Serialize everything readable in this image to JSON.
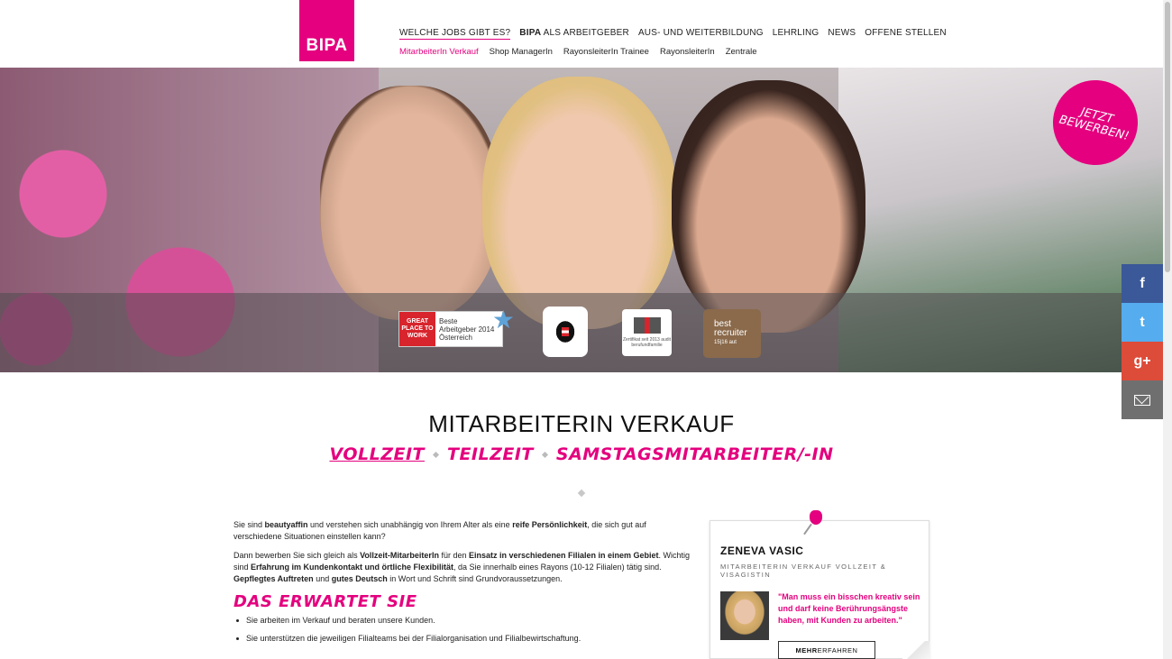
{
  "logo": {
    "text": "BIPA",
    "color": "#e4007e"
  },
  "nav": {
    "main": [
      {
        "pre": "",
        "label": "WELCHE JOBS GIBT ES?",
        "active": true
      },
      {
        "pre": "BIPA",
        "label": " ALS ARBEITGEBER",
        "active": false
      },
      {
        "pre": "",
        "label": "AUS- UND WEITERBILDUNG",
        "active": false
      },
      {
        "pre": "",
        "label": "LEHRLING",
        "active": false
      },
      {
        "pre": "",
        "label": "NEWS",
        "active": false
      },
      {
        "pre": "",
        "label": "OFFENE STELLEN",
        "active": false
      }
    ],
    "sub": [
      {
        "label": "MitarbeiterIn Verkauf",
        "active": true
      },
      {
        "label": "Shop ManagerIn",
        "active": false
      },
      {
        "label": "RayonsleiterIn Trainee",
        "active": false
      },
      {
        "label": "RayonsleiterIn",
        "active": false
      },
      {
        "label": "Zentrale",
        "active": false
      }
    ]
  },
  "hero": {
    "cta_line1": "JETZT",
    "cta_line2": "BEWERBEN!",
    "awards": {
      "gptw": "GREAT PLACE TO WORK",
      "gptw_text1": "Beste",
      "gptw_text2": "Arbeitgeber 2014",
      "gptw_text3": "Österreich",
      "ff_caption": "Zertifikat seit 2013 audit berufundfamilie",
      "recruiter1": "best",
      "recruiter2": "recruiter",
      "recruiter3": "15|16 aut"
    }
  },
  "social": {
    "facebook": "f",
    "twitter": "t",
    "googleplus": "g+",
    "icons": [
      "facebook-icon",
      "twitter-icon",
      "google-plus-icon",
      "mail-icon"
    ]
  },
  "page": {
    "title": "MITARBEITERIN VERKAUF",
    "tabs": [
      {
        "label": "VOLLZEIT",
        "active": true
      },
      {
        "label": "TEILZEIT",
        "active": false
      },
      {
        "label": "SAMSTAGSMITARBEITER/-IN",
        "active": false
      }
    ]
  },
  "content": {
    "p1": {
      "a": "Sie sind ",
      "b": "beautyaffin",
      "c": " und verstehen sich unabhängig von Ihrem Alter als eine ",
      "d": "reife Persönlichkeit",
      "e": ", die sich gut auf verschiedene Situationen einstellen kann?"
    },
    "p2": {
      "a": "Dann bewerben Sie sich gleich als ",
      "b": "Vollzeit-MitarbeiterIn",
      "c": " für den ",
      "d": "Einsatz in verschiedenen Filialen in einem Gebiet",
      "e": ". Wichtig sind ",
      "f": "Erfahrung im Kundenkontakt und örtliche Flexibilität",
      "g": ", da Sie innerhalb eines Rayons (10-12 Filialen) tätig sind. ",
      "h": "Gepflegtes Auftreten",
      "i": " und ",
      "j": "gutes Deutsch",
      "k": " in Wort und Schrift sind Grundvoraussetzungen."
    },
    "heading": "DAS ERWARTET SIE",
    "list": [
      "Sie arbeiten im Verkauf und beraten unsere Kunden.",
      "Sie unterstützen die jeweiligen Filialteams bei der Filialorganisation und Filialbewirtschaftung."
    ]
  },
  "testimonial": {
    "name": "ZENEVA VASIC",
    "role": "MITARBEITERIN VERKAUF VOLLZEIT & VISAGISTIN",
    "quote": "\"Man muss ein bisschen kreativ sein und darf keine Berührungsängste haben, mit Kunden zu arbeiten.\"",
    "button_bold": "MEHR",
    "button_rest": " ERFAHREN"
  }
}
